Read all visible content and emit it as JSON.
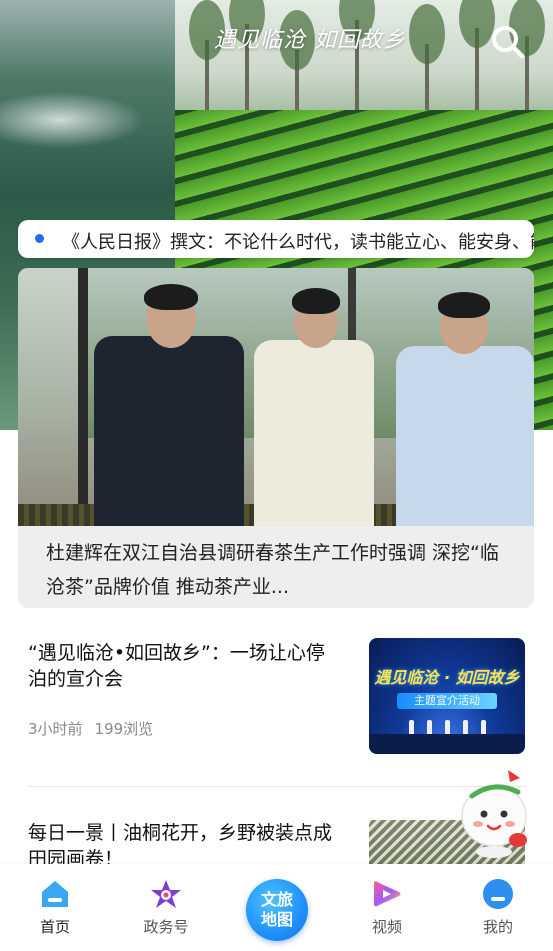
{
  "hero": {
    "title": "遇见临沧 如回故乡"
  },
  "ticker": {
    "text": "《人民日报》撰文：不论什么时代，读书能立心、能安身、能"
  },
  "feature": {
    "caption": "杜建辉在双江自治县调研春茶生产工作时强调 深挖“临沧茶”品牌价值 推动茶产业..."
  },
  "articles": [
    {
      "title": "“遇见临沧•如回故乡”：一场让心停泊的宣介会",
      "time": "3小时前",
      "views": "199浏览",
      "thumb": {
        "line1": "遇见临沧 · 如回故乡",
        "line2": "主题宣介活动"
      }
    },
    {
      "title": "每日一景丨油桐花开，乡野被装点成田园画卷！"
    }
  ],
  "tabbar": {
    "home": "首页",
    "gov": "政务号",
    "map": "文旅地图",
    "video": "视频",
    "mine": "我的"
  },
  "icons": {
    "search": "search-icon",
    "home": "house-icon",
    "gov": "star-icon",
    "video": "play-icon",
    "mine": "profile-icon"
  },
  "colors": {
    "accent": "#1e90ff",
    "ticker_dot": "#1f6cf0"
  }
}
